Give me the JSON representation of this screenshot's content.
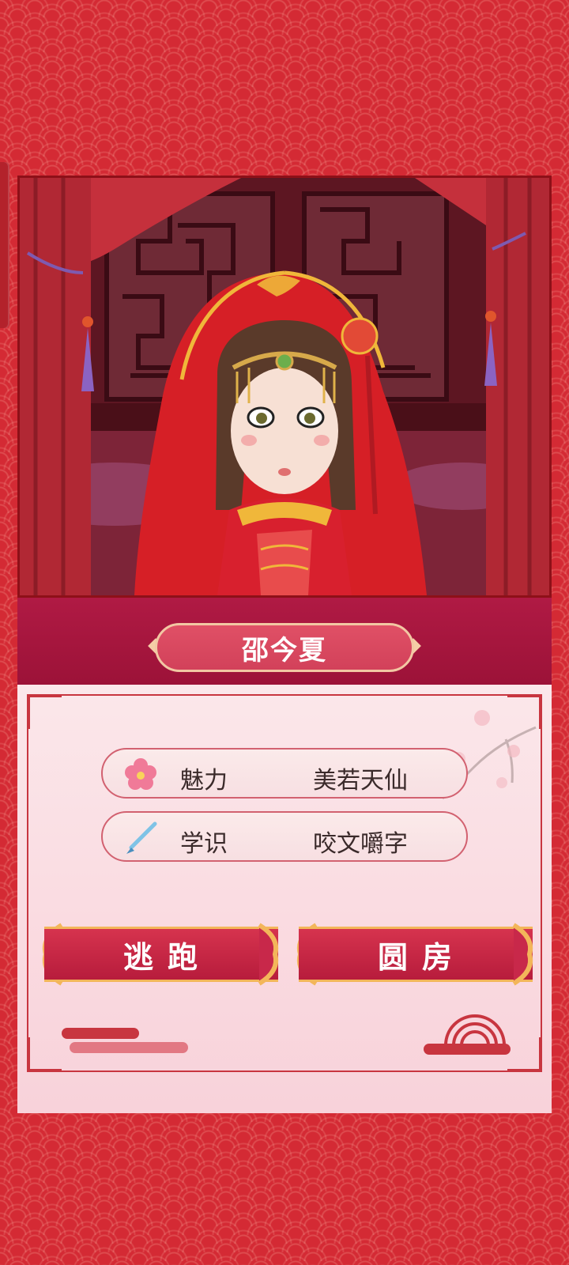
{
  "character": {
    "name": "邵今夏"
  },
  "stats": [
    {
      "icon": "plum-blossom-icon",
      "label": "魅力",
      "value": "美若天仙"
    },
    {
      "icon": "writing-brush-icon",
      "label": "学识",
      "value": "咬文嚼字"
    }
  ],
  "actions": {
    "escape_label": "逃跑",
    "consummate_label": "圆房"
  },
  "colors": {
    "background": "#d42a34",
    "banner": "#b01a44",
    "button": "#c8284a",
    "gold": "#f3b65a",
    "card": "#fbe7ea"
  }
}
